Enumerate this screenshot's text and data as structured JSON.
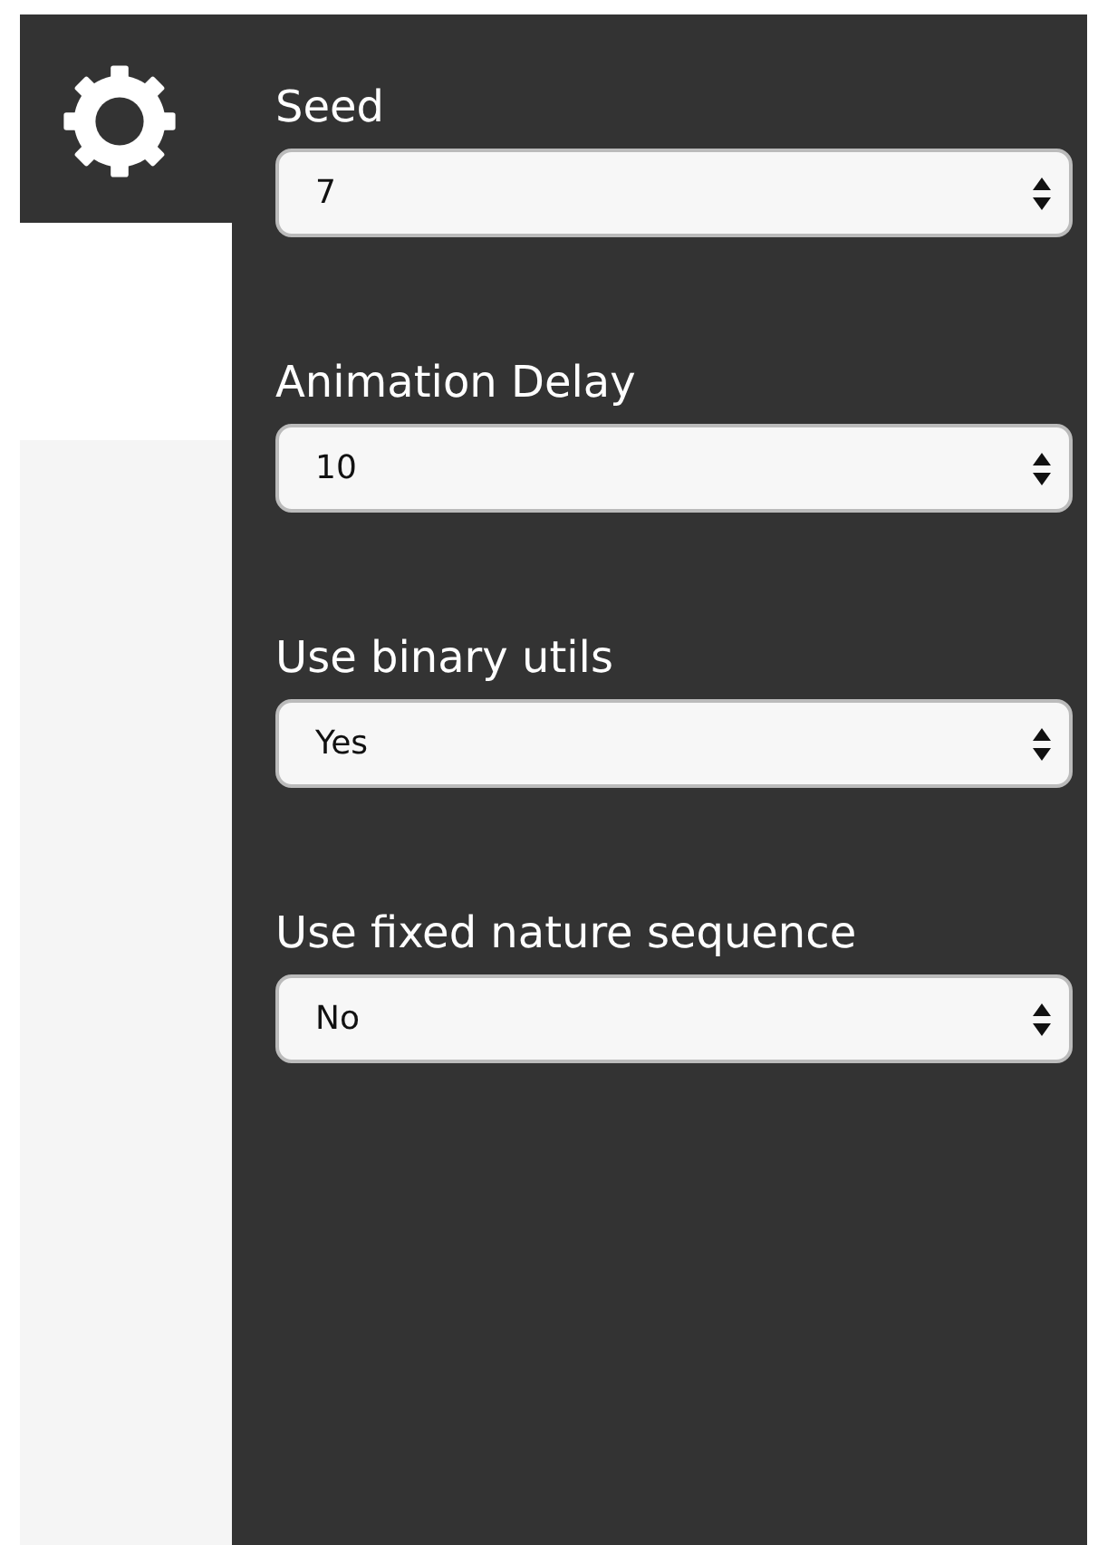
{
  "settings": [
    {
      "label": "Seed",
      "value": "7"
    },
    {
      "label": "Animation Delay",
      "value": "10"
    },
    {
      "label": "Use binary utils",
      "value": "Yes"
    },
    {
      "label": "Use fixed nature sequence",
      "value": "No"
    }
  ]
}
